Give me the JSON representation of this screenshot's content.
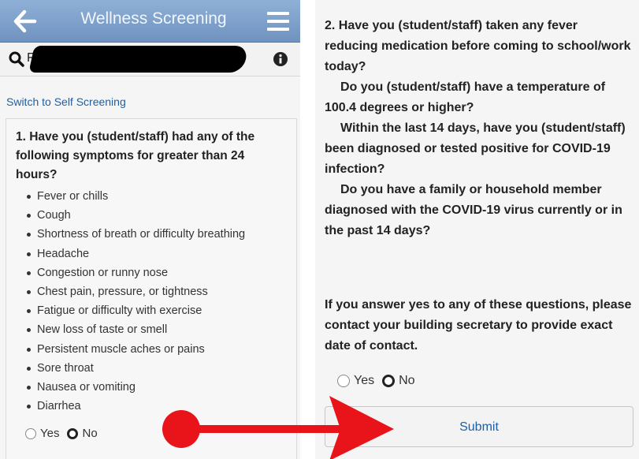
{
  "header": {
    "title": "Wellness Screening"
  },
  "search": {
    "visible_text": "F"
  },
  "switch_link": "Switch to Self Screening",
  "question1": {
    "text": "1. Have you (student/staff) had any of the following symptoms for greater than 24 hours?",
    "symptoms": [
      "Fever or chills",
      "Cough",
      "Shortness of breath or difficulty breathing",
      "Headache",
      "Congestion or runny nose",
      "Chest pain, pressure, or tightness",
      "Fatigue or difficulty with exercise",
      "New loss of taste or smell",
      "Persistent muscle aches or pains",
      "Sore throat",
      "Nausea or vomiting",
      "Diarrhea"
    ],
    "options": {
      "yes": "Yes",
      "no": "No",
      "selected": "No"
    }
  },
  "question2": {
    "lines": [
      "2. Have you (student/staff) taken any fever reducing medication before coming to school/work today?",
      "Do you (student/staff) have a temperature of 100.4 degrees or higher?",
      "Within the last 14 days, have you (student/staff) been diagnosed or tested positive for COVID-19 infection?",
      "Do you have a family or household member diagnosed with the COVID-19 virus currently or in the past 14 days?"
    ],
    "note": "If you answer yes to any of these questions, please contact your building secretary to provide exact date of contact.",
    "options": {
      "yes": "Yes",
      "no": "No",
      "selected": "No"
    }
  },
  "submit_label": "Submit",
  "colors": {
    "header": "#7c9fca",
    "link": "#1c5fa8",
    "annotation": "#e8141a",
    "redaction": "#000000"
  },
  "icons": [
    "back-arrow-icon",
    "hamburger-menu-icon",
    "search-icon",
    "info-icon"
  ]
}
